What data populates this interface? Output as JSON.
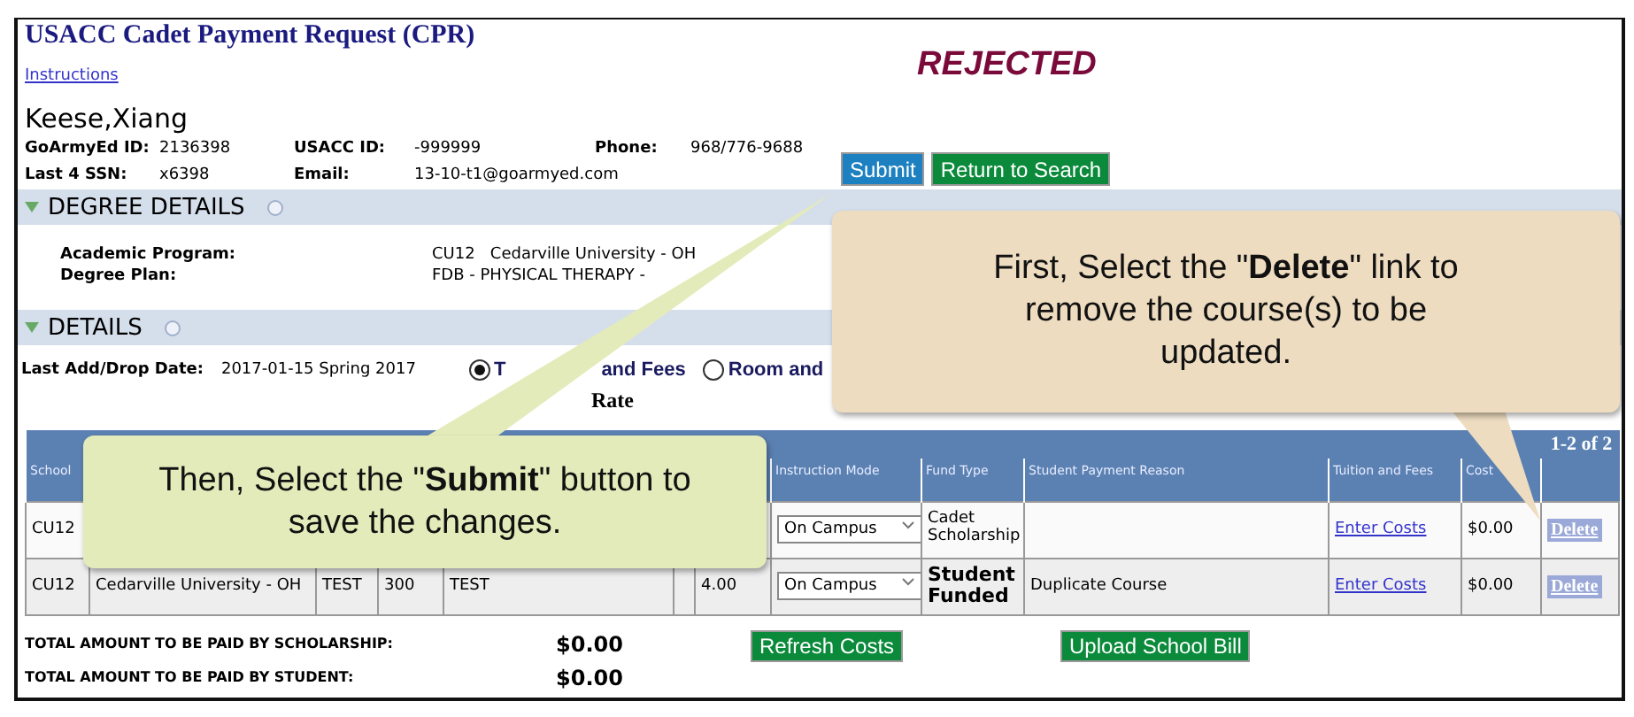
{
  "title": "USACC Cadet Payment Request (CPR)",
  "instructions_link": "Instructions",
  "status": "REJECTED",
  "student_name": "Keese,Xiang",
  "info": [
    {
      "label": "GoArmyEd ID:",
      "value": "2136398"
    },
    {
      "label": "USACC ID:",
      "value": "-999999"
    },
    {
      "label": "Phone:",
      "value": "968/776-9688"
    },
    {
      "label": "Last 4 SSN:",
      "value": "x6398"
    },
    {
      "label": "Email:",
      "value": "13-10-t1@goarmyed.com"
    }
  ],
  "buttons": [
    {
      "label": "Submit",
      "kind": "primary"
    },
    {
      "label": "Return to Search",
      "kind": "success"
    }
  ],
  "degree_details": {
    "title": "DEGREE DETAILS",
    "expanded": true,
    "fields": [
      {
        "label": "Academic Program:",
        "value": "CU12   Cedarville University - OH"
      },
      {
        "label": "Degree Plan:",
        "value": "FDB - PHYSICAL THERAPY -"
      }
    ]
  },
  "details": {
    "title": "DETAILS",
    "expanded": true,
    "add_drop_label": "Last Add/Drop Date:",
    "add_drop_value": "2017-01-15 Spring 2017",
    "radios": [
      {
        "label": "T",
        "label_tail": "and Fees",
        "selected": true
      },
      {
        "label": "Room and",
        "selected": false
      }
    ],
    "rate_label": "Rate"
  },
  "table": {
    "pager": "1-2 of 2",
    "columns": [
      {
        "label": "School"
      },
      {},
      {},
      {},
      {},
      {},
      {},
      {
        "label": "Instruction Mode"
      },
      {
        "label": "Fund Type"
      },
      {
        "label": "Student Payment Reason"
      },
      {
        "label": "Tuition and Fees"
      },
      {
        "label": "Cost"
      },
      {}
    ],
    "rows": [
      {
        "cells": [
          "CU12",
          "",
          "",
          "",
          "",
          "",
          ""
        ],
        "instruction_mode": "On Campus",
        "fund_type": "Cadet Scholarship",
        "fund_bold": false,
        "reason": "",
        "tuition_link": "Enter Costs",
        "cost": "$0.00",
        "action": "Delete"
      },
      {
        "cells": [
          "CU12",
          "Cedarville University - OH",
          "TEST",
          "300",
          "TEST",
          "",
          "4.00"
        ],
        "instruction_mode": "On Campus",
        "fund_type": "Student Funded",
        "fund_bold": true,
        "reason": "Duplicate Course",
        "tuition_link": "Enter Costs",
        "cost": "$0.00",
        "action": "Delete"
      }
    ]
  },
  "totals": [
    {
      "label": "TOTAL AMOUNT TO BE PAID BY SCHOLARSHIP:",
      "value": "$0.00"
    },
    {
      "label": "TOTAL AMOUNT TO BE PAID BY STUDENT:",
      "value": "$0.00"
    }
  ],
  "bottom_buttons": [
    "Refresh Costs",
    "Upload School Bill"
  ],
  "callouts": [
    {
      "kind": "tan",
      "text": "First, Select the \"**Delete**\" link to remove the course(s) to be updated."
    },
    {
      "kind": "green",
      "text": "Then, Select the \"**Submit**\" button to save the changes."
    }
  ]
}
